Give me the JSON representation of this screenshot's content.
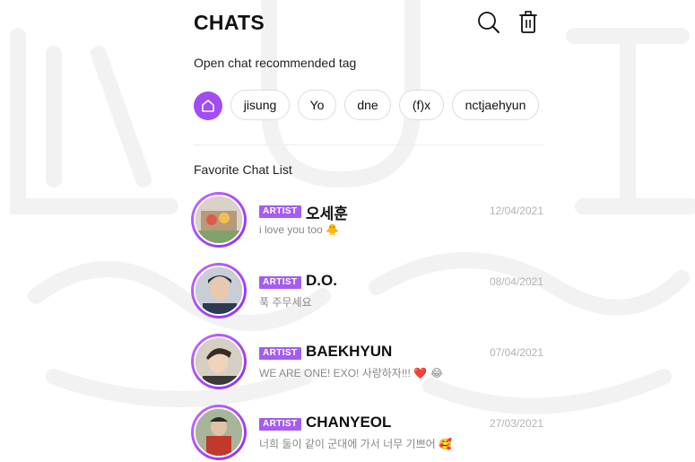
{
  "header": {
    "title": "CHATS",
    "search_icon": "search-icon",
    "trash_icon": "trash-icon"
  },
  "tags_section": {
    "label": "Open chat recommended tag",
    "home_icon": "home-icon",
    "tags": [
      "jisung",
      "Yo",
      "dne",
      "(f)x",
      "nctjaehyun"
    ]
  },
  "favorites": {
    "label": "Favorite Chat List",
    "items": [
      {
        "badge": "ARTIST",
        "name": "오세훈",
        "date": "12/04/2021",
        "message": "i love you too",
        "emoji": "🐥"
      },
      {
        "badge": "ARTIST",
        "name": "D.O.",
        "date": "08/04/2021",
        "message": "푹 주무세요",
        "emoji": ""
      },
      {
        "badge": "ARTIST",
        "name": "BAEKHYUN",
        "date": "07/04/2021",
        "message": "WE ARE ONE! EXO! 사랑하자!!!",
        "emoji": "❤️ 😂"
      },
      {
        "badge": "ARTIST",
        "name": "CHANYEOL",
        "date": "27/03/2021",
        "message": "너희 둘이 같이 군대에 가서 너무 기쁘어",
        "emoji": "🥰"
      }
    ]
  },
  "colors": {
    "accent": "#a14cf4",
    "badge": "#a55cf0",
    "date": "#b3b3b3",
    "message": "#888888"
  }
}
